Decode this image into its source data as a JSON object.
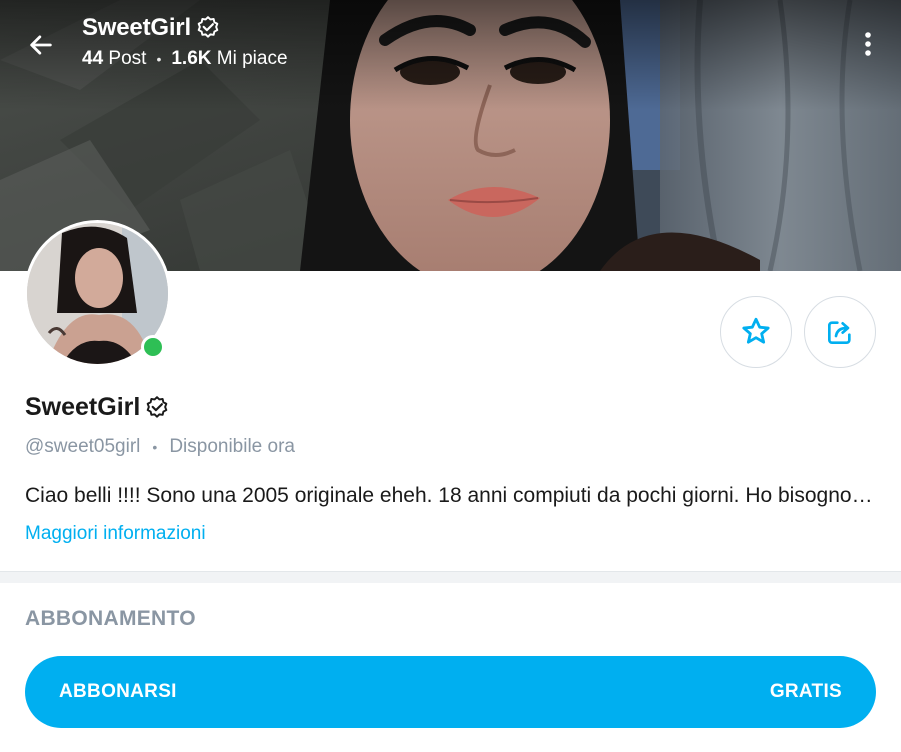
{
  "header": {
    "name": "SweetGirl",
    "posts_count": "44",
    "posts_label": "Post",
    "likes_count": "1.6K",
    "likes_label": "Mi piace",
    "separator": "•"
  },
  "profile": {
    "name": "SweetGirl",
    "handle": "@sweet05girl",
    "separator": "•",
    "status": "Disponibile ora",
    "online": true,
    "bio": "Ciao belli !!!! Sono una 2005 originale eheh. 18 anni compiuti da pochi giorni. Ho bisogno di affetto e di attenzioni 😘",
    "more_info_label": "Maggiori informazioni"
  },
  "subscription": {
    "section_title": "ABBONAMENTO",
    "button_label": "ABBONARSI",
    "price_label": "GRATIS"
  },
  "icons": {
    "back": "back-arrow-icon",
    "verified": "verified-badge-icon",
    "more": "more-vertical-icon",
    "star": "star-icon",
    "share": "share-icon"
  },
  "colors": {
    "accent": "#00aff0",
    "online": "#2ebf55",
    "muted_text": "#8a96a3",
    "main_text": "#1a1a1a"
  }
}
